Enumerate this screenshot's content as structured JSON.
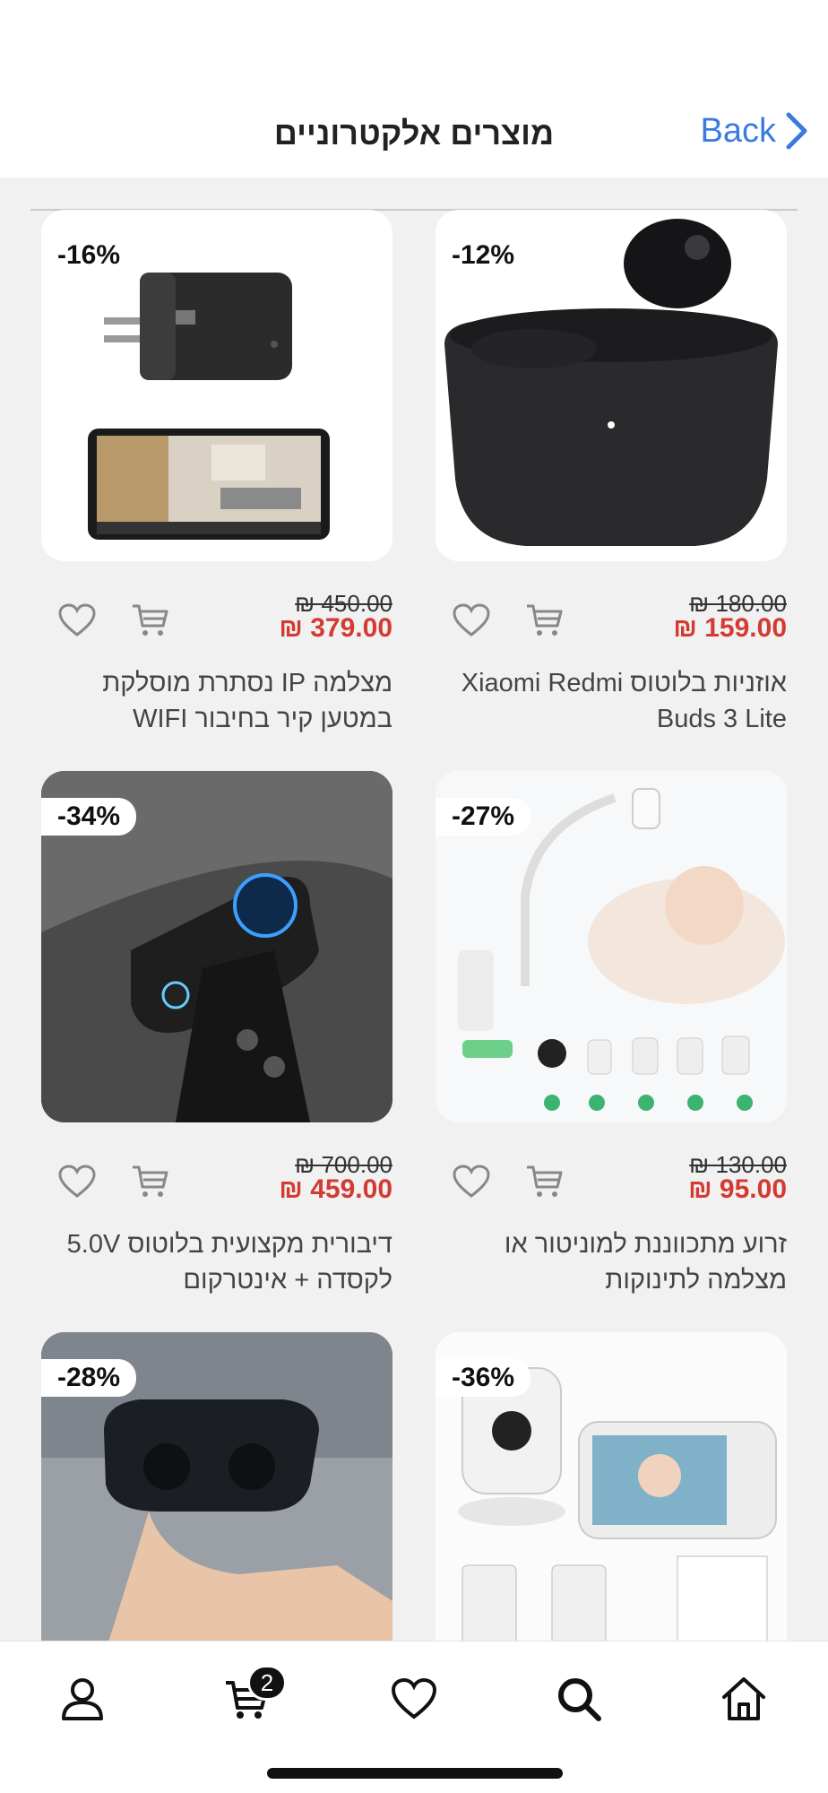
{
  "header": {
    "title": "מוצרים אלקטרוניים",
    "back_label": "Back"
  },
  "products": [
    {
      "badge": "-16%",
      "old_price": "₪ 450.00",
      "new_price": "₪ 379.00",
      "title": "מצלמה IP נסתרת מוסלקת במטען קיר בחיבור WIFI",
      "image": "hidden-charger-camera-with-phone"
    },
    {
      "badge": "-12%",
      "old_price": "₪ 180.00",
      "new_price": "₪ 159.00",
      "title": "אוזניות בלוטוס Xiaomi Redmi Buds 3 Lite",
      "image": "black-earbuds-case"
    },
    {
      "badge": "-34%",
      "old_price": "₪ 700.00",
      "new_price": "₪ 459.00",
      "title": "דיבורית מקצועית בלוטוס 5.0V לקסדה + אינטרקום",
      "image": "helmet-intercom-fx8"
    },
    {
      "badge": "-27%",
      "old_price": "₪ 130.00",
      "new_price": "₪ 95.00",
      "title": "זרוע מתכווננת למוניטור או מצלמה לתינוקות",
      "image": "baby-monitor-arm"
    },
    {
      "badge": "-28%",
      "old_price": "",
      "new_price": "",
      "title": "",
      "image": "earbuds-in-hand"
    },
    {
      "badge": "-36%",
      "old_price": "",
      "new_price": "",
      "title": "",
      "image": "baby-video-monitor-kit"
    }
  ],
  "tabbar": {
    "cart_count": "2",
    "items": [
      "profile-icon",
      "cart-icon",
      "heart-icon",
      "search-icon",
      "home-icon"
    ]
  },
  "colors": {
    "accent": "#3a7be0",
    "price_red": "#d33b32",
    "background": "#f1f1f1"
  }
}
